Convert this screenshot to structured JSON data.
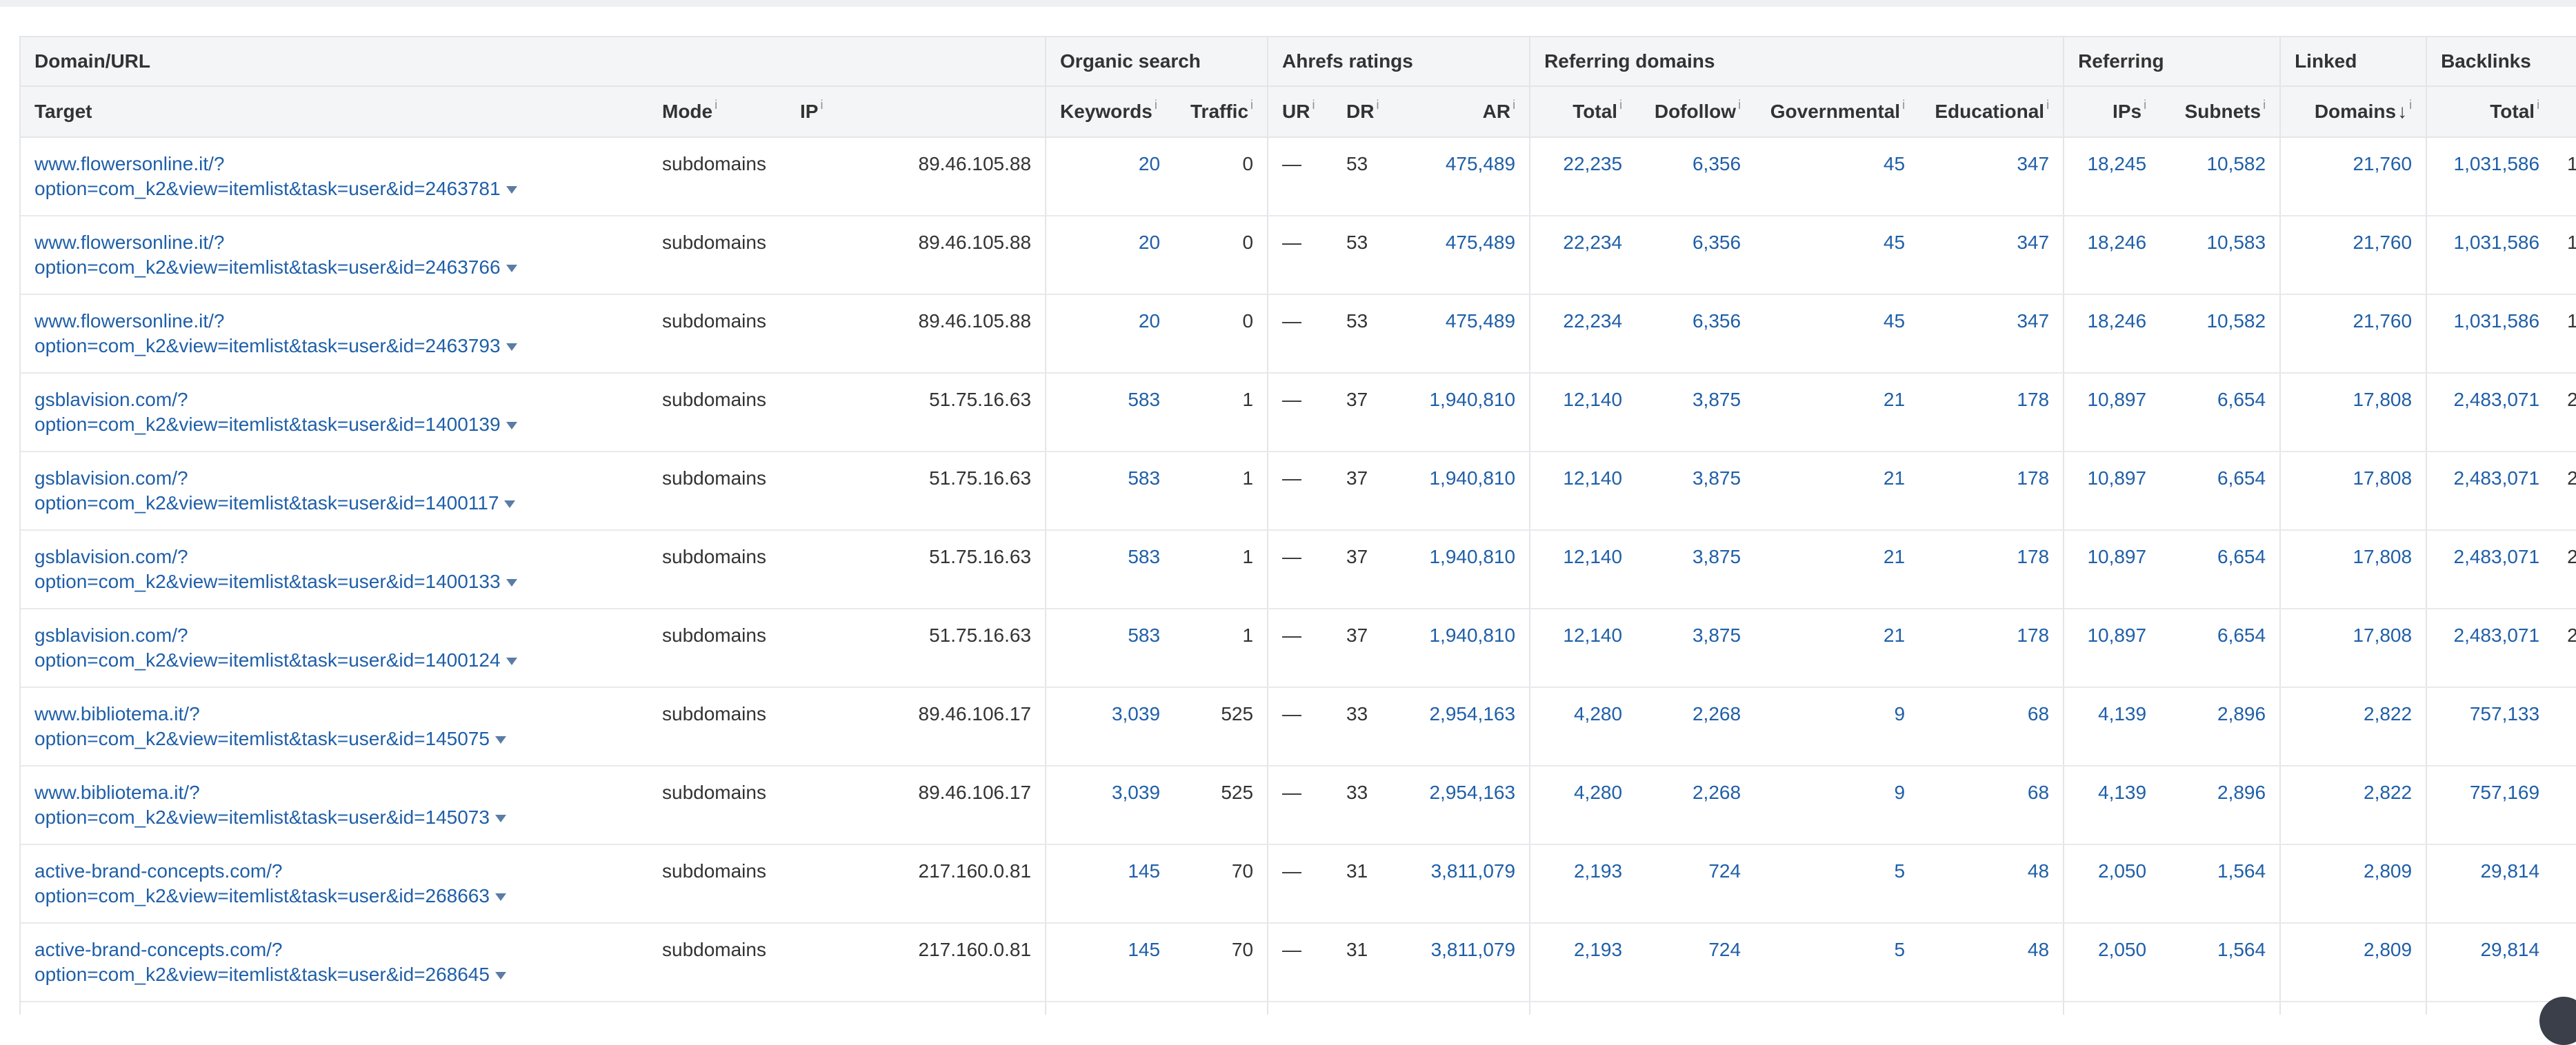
{
  "group_headers": {
    "domain_url": "Domain/URL",
    "organic_search": "Organic search",
    "ahrefs_ratings": "Ahrefs ratings",
    "referring_domains": "Referring domains",
    "referring": "Referring",
    "linked": "Linked",
    "backlinks": "Backlinks"
  },
  "columns": {
    "target": "Target",
    "mode": "Mode",
    "ip": "IP",
    "keywords": "Keywords",
    "traffic": "Traffic",
    "ur": "UR",
    "dr": "DR",
    "ar": "AR",
    "rd_total": "Total",
    "dofollow": "Dofollow",
    "governmental": "Governmental",
    "educational": "Educational",
    "ips": "IPs",
    "subnets": "Subnets",
    "linked_domains": "Domains",
    "sort_arrow": "↓",
    "bl_total": "Total"
  },
  "info_mark": "i",
  "rows": [
    {
      "url1": "www.flowersonline.it/?",
      "url2": "option=com_k2&view=itemlist&task=user&id=2463781",
      "mode": "subdomains",
      "ip": "89.46.105.88",
      "keywords": "20",
      "traffic": "0",
      "ur": "—",
      "dr": "53",
      "ar": "475,489",
      "rd_total": "22,235",
      "dofollow": "6,356",
      "gov": "45",
      "edu": "347",
      "ips": "18,245",
      "subnets": "10,582",
      "linked": "21,760",
      "bl_total": "1,031,586",
      "overflow": "1,"
    },
    {
      "url1": "www.flowersonline.it/?",
      "url2": "option=com_k2&view=itemlist&task=user&id=2463766",
      "mode": "subdomains",
      "ip": "89.46.105.88",
      "keywords": "20",
      "traffic": "0",
      "ur": "—",
      "dr": "53",
      "ar": "475,489",
      "rd_total": "22,234",
      "dofollow": "6,356",
      "gov": "45",
      "edu": "347",
      "ips": "18,246",
      "subnets": "10,583",
      "linked": "21,760",
      "bl_total": "1,031,586",
      "overflow": "1,"
    },
    {
      "url1": "www.flowersonline.it/?",
      "url2": "option=com_k2&view=itemlist&task=user&id=2463793",
      "mode": "subdomains",
      "ip": "89.46.105.88",
      "keywords": "20",
      "traffic": "0",
      "ur": "—",
      "dr": "53",
      "ar": "475,489",
      "rd_total": "22,234",
      "dofollow": "6,356",
      "gov": "45",
      "edu": "347",
      "ips": "18,246",
      "subnets": "10,582",
      "linked": "21,760",
      "bl_total": "1,031,586",
      "overflow": "1,"
    },
    {
      "url1": "gsblavision.com/?",
      "url2": "option=com_k2&view=itemlist&task=user&id=1400139",
      "mode": "subdomains",
      "ip": "51.75.16.63",
      "keywords": "583",
      "traffic": "1",
      "ur": "—",
      "dr": "37",
      "ar": "1,940,810",
      "rd_total": "12,140",
      "dofollow": "3,875",
      "gov": "21",
      "edu": "178",
      "ips": "10,897",
      "subnets": "6,654",
      "linked": "17,808",
      "bl_total": "2,483,071",
      "overflow": "2,"
    },
    {
      "url1": "gsblavision.com/?",
      "url2": "option=com_k2&view=itemlist&task=user&id=1400117",
      "mode": "subdomains",
      "ip": "51.75.16.63",
      "keywords": "583",
      "traffic": "1",
      "ur": "—",
      "dr": "37",
      "ar": "1,940,810",
      "rd_total": "12,140",
      "dofollow": "3,875",
      "gov": "21",
      "edu": "178",
      "ips": "10,897",
      "subnets": "6,654",
      "linked": "17,808",
      "bl_total": "2,483,071",
      "overflow": "2,"
    },
    {
      "url1": "gsblavision.com/?",
      "url2": "option=com_k2&view=itemlist&task=user&id=1400133",
      "mode": "subdomains",
      "ip": "51.75.16.63",
      "keywords": "583",
      "traffic": "1",
      "ur": "—",
      "dr": "37",
      "ar": "1,940,810",
      "rd_total": "12,140",
      "dofollow": "3,875",
      "gov": "21",
      "edu": "178",
      "ips": "10,897",
      "subnets": "6,654",
      "linked": "17,808",
      "bl_total": "2,483,071",
      "overflow": "2,"
    },
    {
      "url1": "gsblavision.com/?",
      "url2": "option=com_k2&view=itemlist&task=user&id=1400124",
      "mode": "subdomains",
      "ip": "51.75.16.63",
      "keywords": "583",
      "traffic": "1",
      "ur": "—",
      "dr": "37",
      "ar": "1,940,810",
      "rd_total": "12,140",
      "dofollow": "3,875",
      "gov": "21",
      "edu": "178",
      "ips": "10,897",
      "subnets": "6,654",
      "linked": "17,808",
      "bl_total": "2,483,071",
      "overflow": "2,"
    },
    {
      "url1": "www.bibliotema.it/?",
      "url2": "option=com_k2&view=itemlist&task=user&id=145075",
      "mode": "subdomains",
      "ip": "89.46.106.17",
      "keywords": "3,039",
      "traffic": "525",
      "ur": "—",
      "dr": "33",
      "ar": "2,954,163",
      "rd_total": "4,280",
      "dofollow": "2,268",
      "gov": "9",
      "edu": "68",
      "ips": "4,139",
      "subnets": "2,896",
      "linked": "2,822",
      "bl_total": "757,133",
      "overflow": ""
    },
    {
      "url1": "www.bibliotema.it/?",
      "url2": "option=com_k2&view=itemlist&task=user&id=145073",
      "mode": "subdomains",
      "ip": "89.46.106.17",
      "keywords": "3,039",
      "traffic": "525",
      "ur": "—",
      "dr": "33",
      "ar": "2,954,163",
      "rd_total": "4,280",
      "dofollow": "2,268",
      "gov": "9",
      "edu": "68",
      "ips": "4,139",
      "subnets": "2,896",
      "linked": "2,822",
      "bl_total": "757,169",
      "overflow": ""
    },
    {
      "url1": "active-brand-concepts.com/?",
      "url2": "option=com_k2&view=itemlist&task=user&id=268663",
      "mode": "subdomains",
      "ip": "217.160.0.81",
      "keywords": "145",
      "traffic": "70",
      "ur": "—",
      "dr": "31",
      "ar": "3,811,079",
      "rd_total": "2,193",
      "dofollow": "724",
      "gov": "5",
      "edu": "48",
      "ips": "2,050",
      "subnets": "1,564",
      "linked": "2,809",
      "bl_total": "29,814",
      "overflow": ""
    },
    {
      "url1": "active-brand-concepts.com/?",
      "url2": "option=com_k2&view=itemlist&task=user&id=268645",
      "mode": "subdomains",
      "ip": "217.160.0.81",
      "keywords": "145",
      "traffic": "70",
      "ur": "—",
      "dr": "31",
      "ar": "3,811,079",
      "rd_total": "2,193",
      "dofollow": "724",
      "gov": "5",
      "edu": "48",
      "ips": "2,050",
      "subnets": "1,564",
      "linked": "2,809",
      "bl_total": "29,814",
      "overflow": ""
    }
  ]
}
